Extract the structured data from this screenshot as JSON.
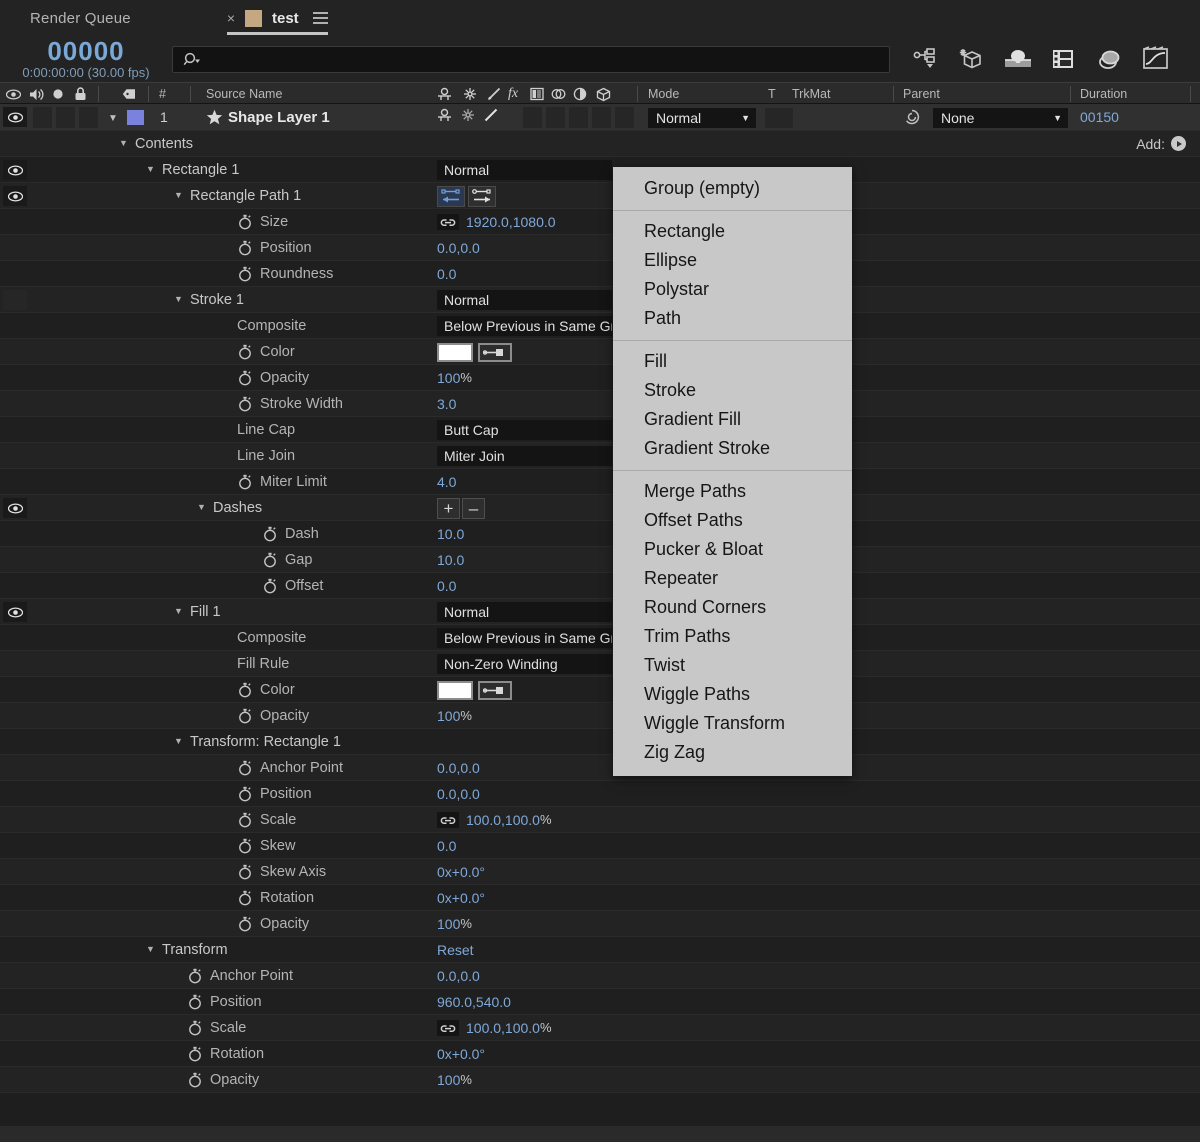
{
  "tabs": {
    "inactive_label": "Render Queue",
    "active": {
      "close": "×",
      "label": "test",
      "menu_icon": "hamburger-icon"
    }
  },
  "toolbar": {
    "timecode": "00000",
    "timecode_sub": "0:00:00:00 (30.00 fps)",
    "search_placeholder": "",
    "search_icon": "search-icon",
    "icons": [
      "comp-flowchart-icon",
      "new-composition-icon",
      "motion-blur-3d-icon",
      "film-strip-icon",
      "draft-3d-icon",
      "graph-editor-icon"
    ]
  },
  "columns": {
    "headers": [
      "Source Name",
      "Mode",
      "T",
      "TrkMat",
      "Parent",
      "Duration"
    ],
    "icons": [
      "eye-icon",
      "audio-icon",
      "solo-icon",
      "lock-icon",
      "label-icon",
      "number-icon",
      "shy-icon",
      "collapse-icon",
      "quality-icon",
      "fx-icon",
      "frameblend-icon",
      "motionblur-icon",
      "adjustment-icon",
      "3dlayer-icon"
    ]
  },
  "layer": {
    "index": "1",
    "name": "Shape Layer 1",
    "mode": "Normal",
    "parent": "None",
    "duration": "00150",
    "star_icon": "shape-star-icon",
    "parent_pick_icon": "pickwhip-icon"
  },
  "add_menu": {
    "label": "Add:",
    "items": [
      "Group (empty)",
      "Rectangle",
      "Ellipse",
      "Polystar",
      "Path",
      "Fill",
      "Stroke",
      "Gradient Fill",
      "Gradient Stroke",
      "Merge Paths",
      "Offset Paths",
      "Pucker & Bloat",
      "Repeater",
      "Round Corners",
      "Trim Paths",
      "Twist",
      "Wiggle Paths",
      "Wiggle Transform",
      "Zig Zag"
    ],
    "separators_after": [
      0,
      4,
      8
    ]
  },
  "rows": [
    {
      "label": "Contents",
      "indent": 135,
      "type": "group",
      "twirl": true,
      "eye": "none",
      "add": true
    },
    {
      "label": "Rectangle 1",
      "indent": 162,
      "type": "group",
      "twirl": true,
      "eye": "on",
      "field": "Normal",
      "field_w": 175
    },
    {
      "label": "Rectangle Path 1",
      "indent": 190,
      "type": "group",
      "twirl": true,
      "eye": "on",
      "pathbtns": true
    },
    {
      "label": "Size",
      "indent": 260,
      "stopwatch": true,
      "link": true,
      "value": "1920.0,1080.0",
      "value_x": 466
    },
    {
      "label": "Position",
      "indent": 260,
      "stopwatch": true,
      "value": "0.0,0.0"
    },
    {
      "label": "Roundness",
      "indent": 260,
      "stopwatch": true,
      "value": "0.0"
    },
    {
      "label": "Stroke 1",
      "indent": 190,
      "type": "group",
      "twirl": true,
      "eye": "blank",
      "field": "Normal",
      "field_w": 175
    },
    {
      "label": "Composite",
      "indent": 237,
      "field": "Below Previous in Same Group",
      "field_w": 175
    },
    {
      "label": "Color",
      "indent": 260,
      "stopwatch": true,
      "swatch": "#ffffff"
    },
    {
      "label": "Opacity",
      "indent": 260,
      "stopwatch": true,
      "value": "100",
      "unit": "%"
    },
    {
      "label": "Stroke Width",
      "indent": 260,
      "stopwatch": true,
      "value": "3.0"
    },
    {
      "label": "Line Cap",
      "indent": 237,
      "field": "Butt Cap",
      "field_w": 175
    },
    {
      "label": "Line Join",
      "indent": 237,
      "field": "Miter Join",
      "field_w": 175
    },
    {
      "label": "Miter Limit",
      "indent": 260,
      "stopwatch": true,
      "value": "4.0"
    },
    {
      "label": "Dashes",
      "indent": 213,
      "type": "group",
      "twirl": true,
      "eye": "on",
      "dashbtns": true
    },
    {
      "label": "Dash",
      "indent": 285,
      "stopwatch": true,
      "value": "10.0"
    },
    {
      "label": "Gap",
      "indent": 285,
      "stopwatch": true,
      "value": "10.0"
    },
    {
      "label": "Offset",
      "indent": 285,
      "stopwatch": true,
      "value": "0.0"
    },
    {
      "label": "Fill 1",
      "indent": 190,
      "type": "group",
      "twirl": true,
      "eye": "on",
      "field": "Normal",
      "field_w": 175
    },
    {
      "label": "Composite",
      "indent": 237,
      "field": "Below Previous in Same Group",
      "field_w": 175
    },
    {
      "label": "Fill Rule",
      "indent": 237,
      "field": "Non-Zero Winding",
      "field_w": 175
    },
    {
      "label": "Color",
      "indent": 260,
      "stopwatch": true,
      "swatch": "#ffffff"
    },
    {
      "label": "Opacity",
      "indent": 260,
      "stopwatch": true,
      "value": "100",
      "unit": "%"
    },
    {
      "label": "Transform: Rectangle 1",
      "indent": 190,
      "type": "group",
      "twirl": true,
      "eye": "none"
    },
    {
      "label": "Anchor Point",
      "indent": 260,
      "stopwatch": true,
      "value": "0.0,0.0"
    },
    {
      "label": "Position",
      "indent": 260,
      "stopwatch": true,
      "value": "0.0,0.0"
    },
    {
      "label": "Scale",
      "indent": 260,
      "stopwatch": true,
      "link": true,
      "value": "100.0,100.0",
      "unit": "%",
      "value_x": 466
    },
    {
      "label": "Skew",
      "indent": 260,
      "stopwatch": true,
      "value": "0.0"
    },
    {
      "label": "Skew Axis",
      "indent": 260,
      "stopwatch": true,
      "value": "0x+0.0°"
    },
    {
      "label": "Rotation",
      "indent": 260,
      "stopwatch": true,
      "value": "0x+0.0°"
    },
    {
      "label": "Opacity",
      "indent": 260,
      "stopwatch": true,
      "value": "100",
      "unit": "%"
    },
    {
      "label": "Transform",
      "indent": 162,
      "type": "group",
      "twirl": true,
      "eye": "none",
      "value": "Reset"
    },
    {
      "label": "Anchor Point",
      "indent": 210,
      "stopwatch": true,
      "value": "0.0,0.0"
    },
    {
      "label": "Position",
      "indent": 210,
      "stopwatch": true,
      "value": "960.0,540.0"
    },
    {
      "label": "Scale",
      "indent": 210,
      "stopwatch": true,
      "link": true,
      "value": "100.0,100.0",
      "unit": "%",
      "value_x": 466
    },
    {
      "label": "Rotation",
      "indent": 210,
      "stopwatch": true,
      "value": "0x+0.0°"
    },
    {
      "label": "Opacity",
      "indent": 210,
      "stopwatch": true,
      "value": "100",
      "unit": "%"
    }
  ],
  "colors": {
    "panel_bg": "#232323",
    "value_blue": "#7fa9d8",
    "timecode_blue": "#7aa8d8",
    "layer_swatch": "#7b82dd",
    "tab_swatch": "#c4a882",
    "popup_bg": "#c8c8c8"
  }
}
